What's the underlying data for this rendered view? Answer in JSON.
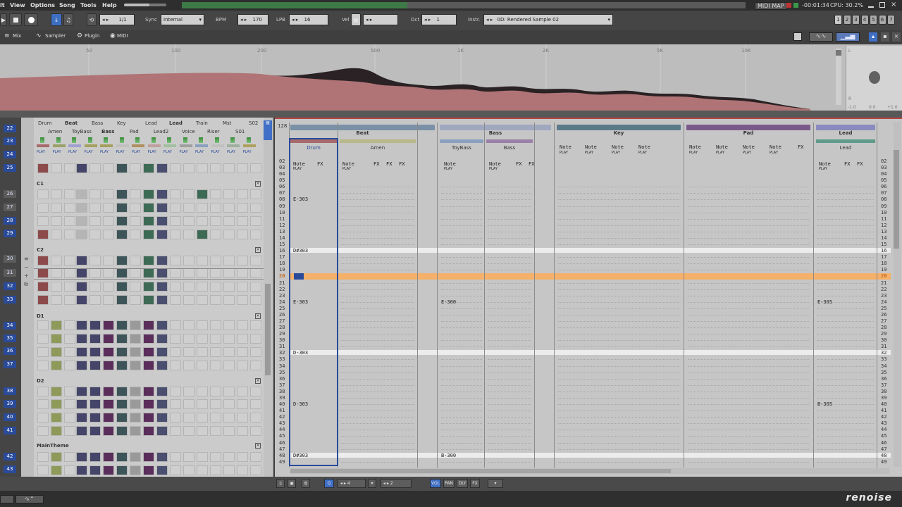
{
  "menu": [
    "lt",
    "View",
    "Options",
    "Song",
    "Tools",
    "Help"
  ],
  "status": {
    "midi_map": "MIDI MAP",
    "time": "-00:01:34",
    "cpu": "CPU: 30.2%"
  },
  "transport": {
    "pattern_pos": "1/1",
    "sync_label": "Sync",
    "sync": "Internal",
    "bpm_label": "BPM",
    "bpm": "170",
    "lpb_label": "LPB",
    "lpb": "16",
    "vel_label": "Vel",
    "oct_label": "Oct",
    "oct": "1",
    "instr_label": "Instr.",
    "instr": "0D: Rendered Sample 02"
  },
  "page_buttons": [
    "1",
    "2",
    "3",
    "4",
    "5",
    "6",
    "7"
  ],
  "tabs": [
    "Mix",
    "Sampler",
    "Plugin",
    "MIDI"
  ],
  "spectrum": {
    "freqs": [
      "50",
      "100",
      "200",
      "500",
      "1K",
      "2K",
      "5K",
      "10K"
    ],
    "db_labels": [
      "L",
      "R",
      "-1.0",
      "0.0",
      "+1.0"
    ]
  },
  "sequence_numbers": [
    "22",
    "23",
    "24",
    "25",
    "26",
    "27",
    "28",
    "29",
    "30",
    "31",
    "32",
    "33",
    "34",
    "35",
    "36",
    "37",
    "38",
    "39",
    "40",
    "41",
    "42",
    "43"
  ],
  "matrix": {
    "heads_top": [
      "Drum",
      "Beat",
      "Bass",
      "Key",
      "Lead",
      "Lead",
      "Train",
      "Mst",
      "S02"
    ],
    "heads_bottom": [
      "Amen",
      "ToyBass",
      "Bass",
      "Pad",
      "Lead2",
      "Voice",
      "Riser",
      "S01"
    ],
    "play": "PLAY",
    "sections": [
      "C1",
      "C2",
      "D1",
      "D2",
      "MainTheme"
    ]
  },
  "editor": {
    "lines_total": "128",
    "groups": [
      "Beat",
      "Bass",
      "Key",
      "Pad",
      "Lead"
    ],
    "tracks": [
      "Drum",
      "Amen",
      "ToyBass",
      "Bass",
      "Lead"
    ],
    "col_labels": {
      "note": "Note",
      "fx": "FX",
      "play": "PLAY"
    },
    "rows": [
      "02",
      "03",
      "04",
      "05",
      "06",
      "07",
      "08",
      "09",
      "10",
      "11",
      "12",
      "13",
      "14",
      "15",
      "16",
      "17",
      "18",
      "19",
      "20",
      "21",
      "22",
      "23",
      "24",
      "25",
      "26",
      "27",
      "28",
      "29",
      "30",
      "31",
      "32",
      "33",
      "34",
      "35",
      "36",
      "37",
      "38",
      "39",
      "40",
      "41",
      "42",
      "43",
      "44",
      "45",
      "46",
      "47",
      "48",
      "49"
    ],
    "notes": {
      "drum": [
        "E-303",
        "D#303",
        "E-303",
        "D-303",
        "D-303",
        "D#303"
      ],
      "bass": [
        "E-300",
        "B-300"
      ],
      "lead": [
        "E-305",
        "B-305"
      ]
    }
  },
  "bottom": {
    "a": "4",
    "b": "2",
    "vol": "VOL",
    "pan": "PAN",
    "dly": "DLY",
    "fx": "FX"
  },
  "logo": "renoise",
  "colors": {
    "spectrum_fill": "#b07476",
    "cursor_row": "#f5b06a",
    "accent": "#2a4b9a"
  }
}
